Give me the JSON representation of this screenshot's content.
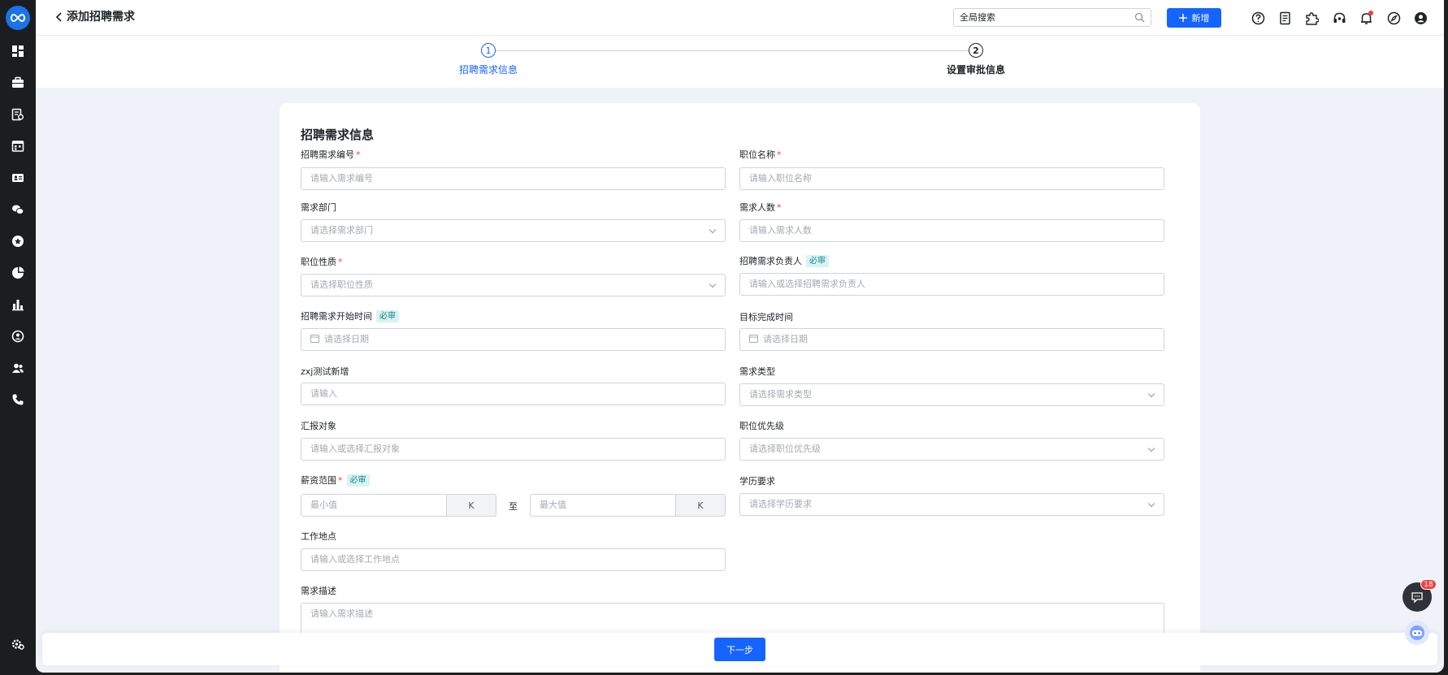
{
  "header": {
    "title": "添加招聘需求",
    "search_placeholder": "全局搜索",
    "new_button": "新增"
  },
  "steps": [
    {
      "number": "1",
      "label": "招聘需求信息",
      "active": true
    },
    {
      "number": "2",
      "label": "设置审批信息",
      "active": false
    }
  ],
  "form": {
    "section_title": "招聘需求信息",
    "fields": {
      "req_no": {
        "label": "招聘需求编号",
        "required": true,
        "placeholder": "请输入需求编号"
      },
      "position_name": {
        "label": "职位名称",
        "required": true,
        "placeholder": "请输入职位名称"
      },
      "department": {
        "label": "需求部门",
        "placeholder": "请选择需求部门"
      },
      "headcount": {
        "label": "需求人数",
        "required": true,
        "placeholder": "请输入需求人数"
      },
      "position_type": {
        "label": "职位性质",
        "required": true,
        "placeholder": "请选择职位性质"
      },
      "owner": {
        "label": "招聘需求负责人",
        "tag": "必审",
        "placeholder": "请输入或选择招聘需求负责人"
      },
      "start_date": {
        "label": "招聘需求开始时间",
        "tag": "必审",
        "placeholder": "请选择日期"
      },
      "target_date": {
        "label": "目标完成时间",
        "placeholder": "请选择日期"
      },
      "zxj": {
        "label": "zxj测试新增",
        "placeholder": "请输入"
      },
      "demand_type": {
        "label": "需求类型",
        "placeholder": "请选择需求类型"
      },
      "report_to": {
        "label": "汇报对象",
        "placeholder": "请输入或选择汇报对象"
      },
      "priority": {
        "label": "职位优先级",
        "placeholder": "请选择职位优先级"
      },
      "salary": {
        "label": "薪资范围",
        "required": true,
        "tag": "必审",
        "min_placeholder": "最小值",
        "max_placeholder": "最大值",
        "unit": "K",
        "to": "至"
      },
      "education": {
        "label": "学历要求",
        "placeholder": "请选择学历要求"
      },
      "location": {
        "label": "工作地点",
        "placeholder": "请输入或选择工作地点"
      },
      "description": {
        "label": "需求描述",
        "placeholder": "请输入需求描述"
      }
    },
    "required_mark": "*"
  },
  "footer": {
    "next_button": "下一步"
  },
  "chat": {
    "badge_count": "18"
  },
  "colors": {
    "primary": "#1664ff",
    "sidebar": "#1b1d21",
    "background": "#eff2f8",
    "required": "#f53f3f",
    "tag_bg": "#d9f2f2"
  }
}
